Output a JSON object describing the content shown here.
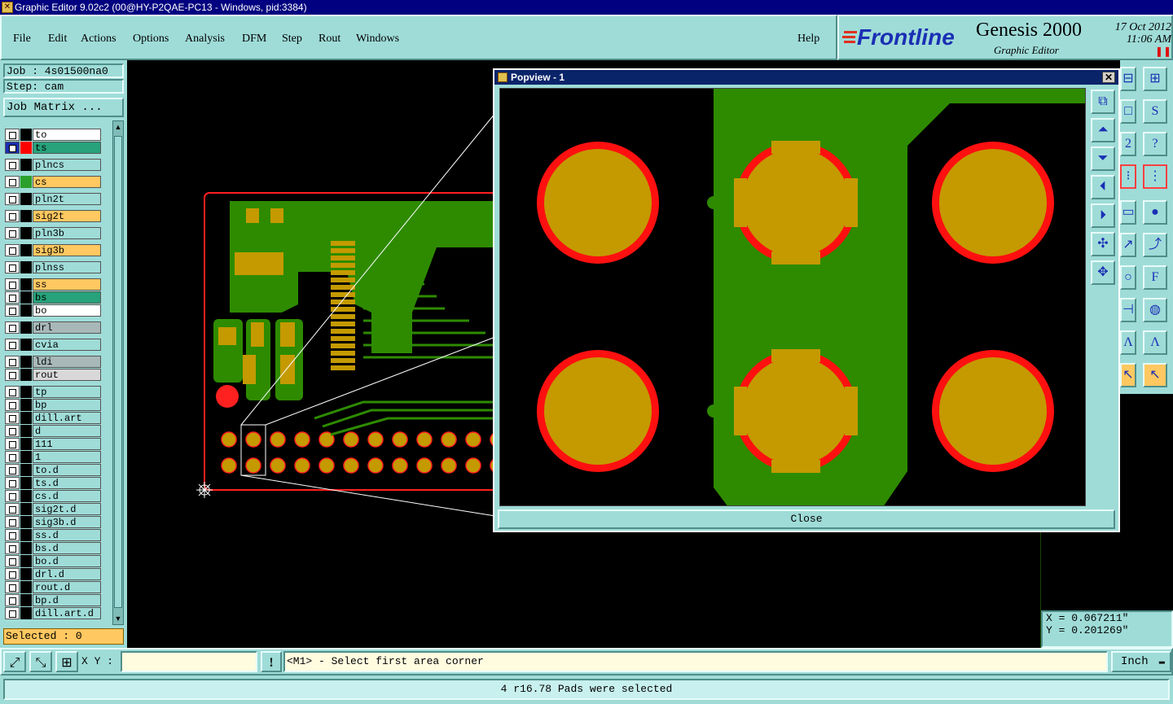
{
  "window": {
    "title": "Graphic Editor 9.02c2 (00@HY-P2QAE-PC13 - Windows, pid:3384)"
  },
  "menu": {
    "items": [
      "File",
      "Edit",
      "Actions",
      "Options",
      "Analysis",
      "DFM",
      "Step",
      "Rout",
      "Windows"
    ],
    "help": "Help"
  },
  "logo": {
    "brand": "Frontline",
    "product": "Genesis 2000",
    "subtitle": "Graphic Editor",
    "date": "17 Oct 2012",
    "time": "11:06 AM"
  },
  "job": {
    "job_line": "Job : 4s01500na0",
    "step_line": "Step: cam",
    "matrix_button": "Job Matrix ..."
  },
  "layers": [
    {
      "name": "to",
      "color": "#ffffff",
      "swatch": "#000000"
    },
    {
      "name": "ts",
      "color": "#27a27a",
      "swatch": "#ff0000",
      "active": true
    },
    {
      "name": "plncs",
      "color": "#9fdcd8",
      "swatch": "#000000"
    },
    {
      "name": "cs",
      "color": "#ffc860",
      "swatch": "#2ca02c"
    },
    {
      "name": "pln2t",
      "color": "#9fdcd8",
      "swatch": "#000000"
    },
    {
      "name": "sig2t",
      "color": "#ffc860",
      "swatch": "#000000"
    },
    {
      "name": "pln3b",
      "color": "#9fdcd8",
      "swatch": "#000000"
    },
    {
      "name": "sig3b",
      "color": "#ffc860",
      "swatch": "#000000"
    },
    {
      "name": "plnss",
      "color": "#9fdcd8",
      "swatch": "#000000"
    },
    {
      "name": "ss",
      "color": "#ffc860",
      "swatch": "#000000"
    },
    {
      "name": "bs",
      "color": "#27a27a",
      "swatch": "#000000"
    },
    {
      "name": "bo",
      "color": "#ffffff",
      "swatch": "#000000"
    },
    {
      "name": "drl",
      "color": "#a8b8b8",
      "swatch": "#000000"
    },
    {
      "name": "cvia",
      "color": "#9fdcd8",
      "swatch": "#000000"
    },
    {
      "name": "ldi",
      "color": "#a8b8b8",
      "swatch": "#000000"
    },
    {
      "name": "rout",
      "color": "#d8d8d8",
      "swatch": "#000000"
    },
    {
      "name": "tp",
      "color": "#9fdcd8",
      "swatch": "#000000"
    },
    {
      "name": "bp",
      "color": "#9fdcd8",
      "swatch": "#000000"
    },
    {
      "name": "dill.art",
      "color": "#9fdcd8",
      "swatch": "#000000"
    },
    {
      "name": "d",
      "color": "#9fdcd8",
      "swatch": "#000000"
    },
    {
      "name": "111",
      "color": "#9fdcd8",
      "swatch": "#000000"
    },
    {
      "name": "1",
      "color": "#9fdcd8",
      "swatch": "#000000"
    },
    {
      "name": "to.d",
      "color": "#9fdcd8",
      "swatch": "#000000"
    },
    {
      "name": "ts.d",
      "color": "#9fdcd8",
      "swatch": "#000000"
    },
    {
      "name": "cs.d",
      "color": "#9fdcd8",
      "swatch": "#000000"
    },
    {
      "name": "sig2t.d",
      "color": "#9fdcd8",
      "swatch": "#000000"
    },
    {
      "name": "sig3b.d",
      "color": "#9fdcd8",
      "swatch": "#000000"
    },
    {
      "name": "ss.d",
      "color": "#9fdcd8",
      "swatch": "#000000"
    },
    {
      "name": "bs.d",
      "color": "#9fdcd8",
      "swatch": "#000000"
    },
    {
      "name": "bo.d",
      "color": "#9fdcd8",
      "swatch": "#000000"
    },
    {
      "name": "drl.d",
      "color": "#9fdcd8",
      "swatch": "#000000"
    },
    {
      "name": "rout.d",
      "color": "#9fdcd8",
      "swatch": "#000000"
    },
    {
      "name": "bp.d",
      "color": "#9fdcd8",
      "swatch": "#000000"
    },
    {
      "name": "dill.art.d",
      "color": "#9fdcd8",
      "swatch": "#000000"
    }
  ],
  "selected": "Selected : 0",
  "popview": {
    "title": "Popview - 1",
    "close_label": "Close"
  },
  "coords": {
    "x": "X  = 0.067211\"",
    "y": "Y  = 0.201269\""
  },
  "bottom": {
    "xy_label": "X Y :",
    "xy_value": "",
    "prompt": "<M1> - Select first area corner",
    "unit": "Inch"
  },
  "status": "4 r16.78 Pads were selected",
  "colors": {
    "panel": "#9fdcd8",
    "copper": "#2e8b00",
    "pad": "#c49a00",
    "outline": "#ff2020"
  }
}
